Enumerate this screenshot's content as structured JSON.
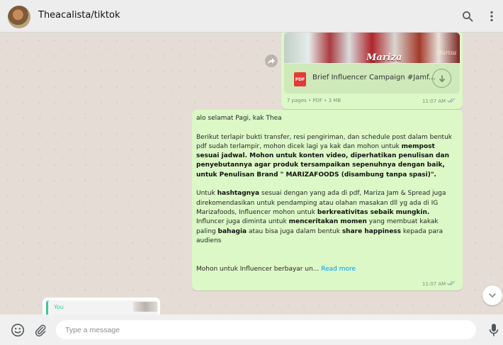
{
  "header": {
    "chat_title": "Theacalista/tiktok",
    "icons": [
      "search-icon",
      "menu-dots-icon"
    ]
  },
  "file_message": {
    "thumbnail_brand": "Mariza",
    "thumbnail_brand_small": "Mariza",
    "file_name": "Brief Influencer Campaign #Jamf...",
    "file_type_label": "PDF",
    "meta": "7 pages • PDF • 3 MB",
    "time": "11:07 AM"
  },
  "text_message": {
    "greeting": "alo selamat Pagi, kak Thea",
    "p2": {
      "a": "Berikut terlapir bukti transfer, resi pengiriman, dan schedule post dalam bentuk pdf sudah terlampir, mohon dicek lagi ya kak dan mohon untuk ",
      "b": "mempost sesuai jadwal. Mohon untuk konten video, diperhatikan penulisan dan penyebutannya agar produk tersampaikan sepenuhnya dengan baik, untuk Penulisan Brand \" MARIZAFOODS (disambung tanpa spasi)\"."
    },
    "p3": {
      "a": "Untuk ",
      "b": "hashtagnya",
      "c": " sesuai dengan yang ada di pdf, Mariza Jam & Spread juga direkomendasikan untuk pendamping atau olahan masakan dll yg ada di IG Marizafoods,  Influencer mohon untuk ",
      "d": "berkreativitas sebaik mungkin.",
      "e": " Influncer juga diminta untuk ",
      "f": "menceritakan momen",
      "g": " yang membuat kakak paling ",
      "h": "bahagia",
      "i": " atau bisa juga dalam bentuk ",
      "j": "share happiness",
      "k": " kepada para audiens"
    },
    "preview": "Mohon untuk Influencer berbayar un...",
    "read_more": "Read more",
    "time": "11:07 AM"
  },
  "reply_preview": {
    "sender": "You"
  },
  "compose": {
    "placeholder": "Type a message",
    "icons": [
      "emoji-icon",
      "attach-icon",
      "mic-icon"
    ]
  },
  "colors": {
    "outgoing_bubble": "#dcf8c6",
    "chat_background": "#e5ddd5",
    "link": "#039be5",
    "read_ticks": "#4fc3f7",
    "pdf_red": "#e53935",
    "quote_accent": "#35cd96"
  }
}
